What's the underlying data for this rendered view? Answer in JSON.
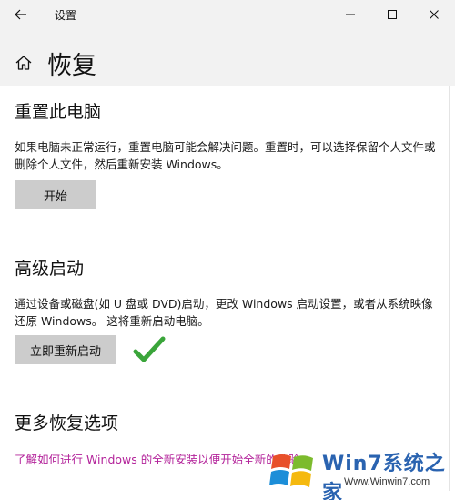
{
  "window": {
    "title": "设置",
    "accent_color": "#0078d7"
  },
  "titlebar": {
    "back_icon": "back-arrow-icon",
    "minimize_icon": "minimize-icon",
    "maximize_icon": "maximize-icon",
    "close_icon": "close-icon"
  },
  "header": {
    "icon": "home-icon",
    "title": "恢复"
  },
  "reset": {
    "title": "重置此电脑",
    "description": "如果电脑未正常运行，重置电脑可能会解决问题。重置时，可以选择保留个人文件或删除个人文件，然后重新安装 Windows。",
    "button_label": "开始"
  },
  "advanced": {
    "title": "高级启动",
    "description": "通过设备或磁盘(如 U 盘或 DVD)启动，更改 Windows 启动设置，或者从系统映像还原 Windows。 这将重新启动电脑。",
    "button_label": "立即重新启动"
  },
  "more": {
    "title": "更多恢复选项",
    "link_text": "了解如何进行 Windows 的全新安装以便开始全新的体验",
    "link_color": "#b3239a"
  },
  "annotation": {
    "icon": "green-check-icon",
    "color": "#3aa53a"
  },
  "watermark": {
    "brand": "Win7系统之家",
    "url": "Www.Winwin7.com"
  }
}
